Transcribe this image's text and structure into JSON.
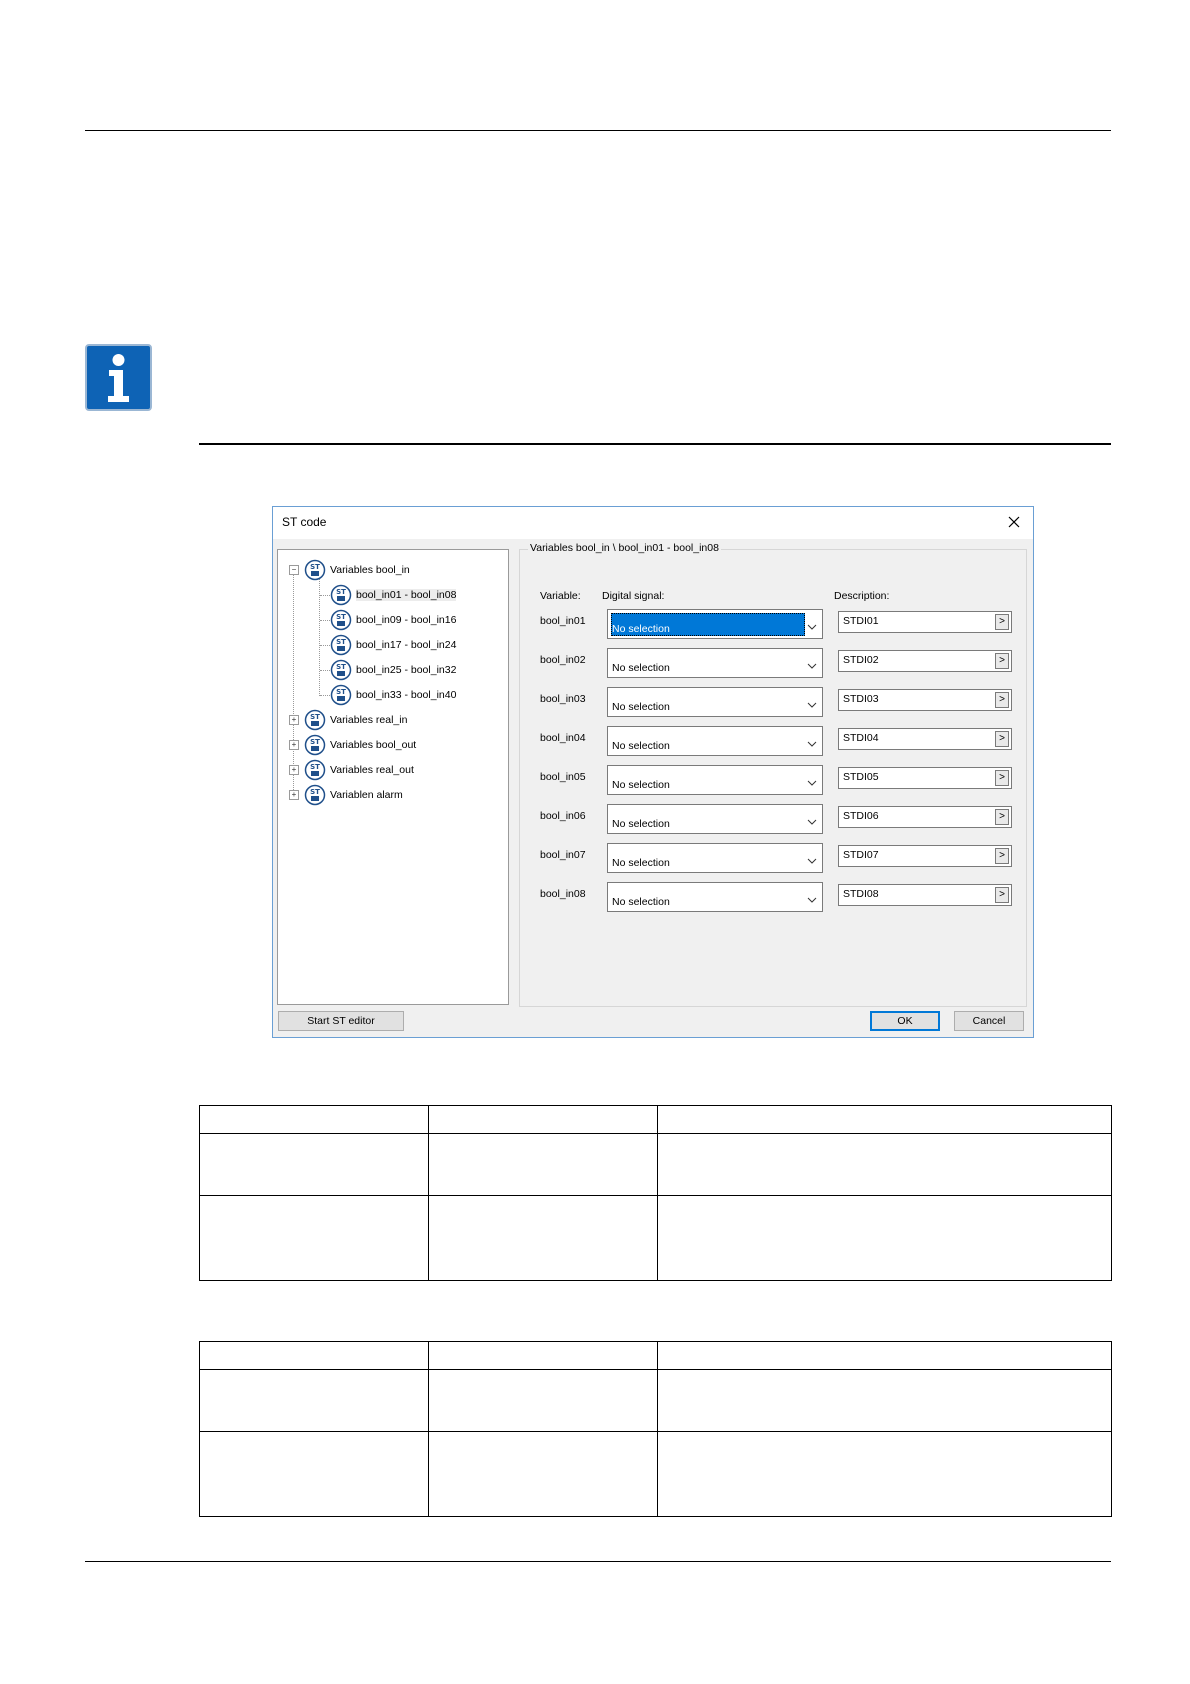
{
  "dialog": {
    "title": "ST code",
    "tree": [
      {
        "label": "Variables bool_in",
        "expander": "−"
      },
      {
        "label": "bool_in01 - bool_in08",
        "selected": true
      },
      {
        "label": "bool_in09 - bool_in16"
      },
      {
        "label": "bool_in17 - bool_in24"
      },
      {
        "label": "bool_in25 - bool_in32"
      },
      {
        "label": "bool_in33 - bool_in40"
      },
      {
        "label": "Variables real_in",
        "expander": "+"
      },
      {
        "label": "Variables bool_out",
        "expander": "+"
      },
      {
        "label": "Variables real_out",
        "expander": "+"
      },
      {
        "label": "Variablen alarm",
        "expander": "+"
      }
    ],
    "group_title": "Variables bool_in \\ bool_in01 - bool_in08",
    "headers": {
      "variable": "Variable:",
      "digital_signal": "Digital signal:",
      "description": "Description:"
    },
    "rows": [
      {
        "variable": "bool_in01",
        "signal": "No selection",
        "description": "STDI01"
      },
      {
        "variable": "bool_in02",
        "signal": "No selection",
        "description": "STDI02"
      },
      {
        "variable": "bool_in03",
        "signal": "No selection",
        "description": "STDI03"
      },
      {
        "variable": "bool_in04",
        "signal": "No selection",
        "description": "STDI04"
      },
      {
        "variable": "bool_in05",
        "signal": "No selection",
        "description": "STDI05"
      },
      {
        "variable": "bool_in06",
        "signal": "No selection",
        "description": "STDI06"
      },
      {
        "variable": "bool_in07",
        "signal": "No selection",
        "description": "STDI07"
      },
      {
        "variable": "bool_in08",
        "signal": "No selection",
        "description": "STDI08"
      }
    ],
    "browse_label": ">",
    "buttons": {
      "start_editor": "Start ST editor",
      "ok": "OK",
      "cancel": "Cancel"
    }
  },
  "colors": {
    "accent": "#0078d7",
    "info_icon": "#0e63b5"
  },
  "icons": {
    "info": "info-icon",
    "st": "st-variable-icon",
    "close": "close-icon",
    "chevron": "chevron-down-icon"
  }
}
